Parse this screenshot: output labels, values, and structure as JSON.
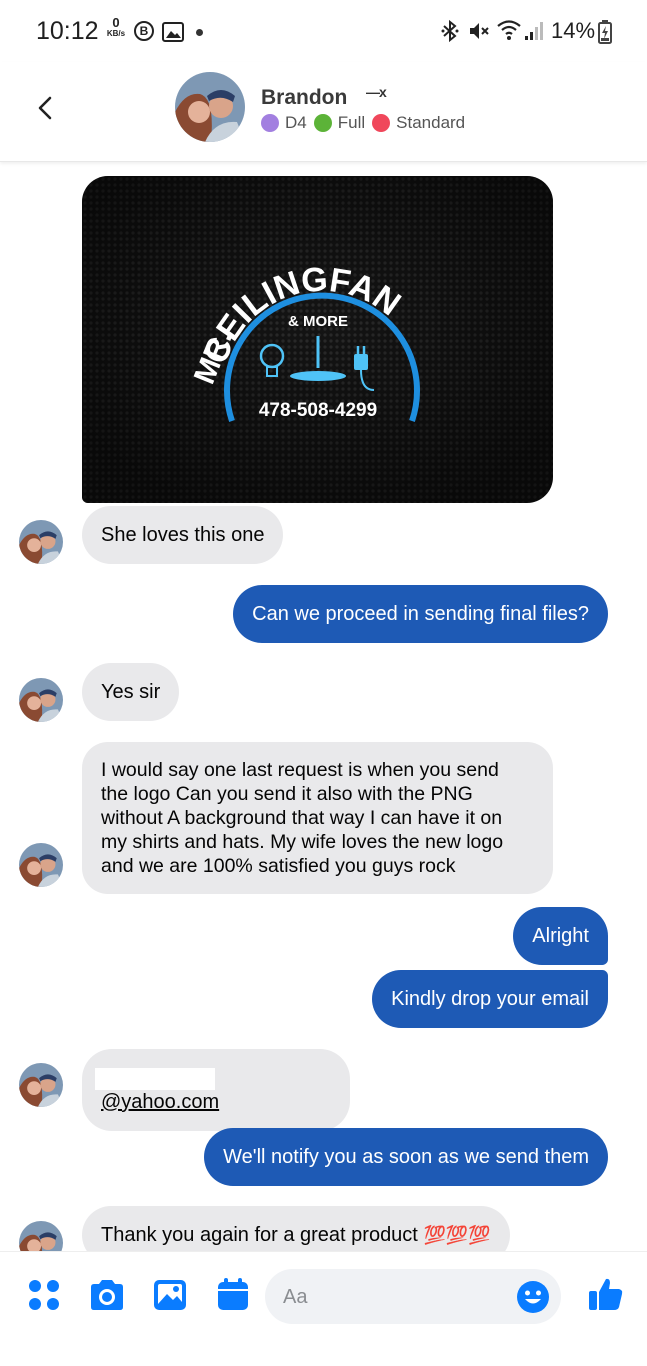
{
  "status_bar": {
    "time": "10:12",
    "net_speed_value": "0",
    "net_speed_unit": "KB/s",
    "notif_letter": "B",
    "battery_percent": "14%"
  },
  "header": {
    "contact_name": "Brandon",
    "contact_name_trailing": "—x",
    "tags": [
      {
        "label": "D4",
        "color": "#a27fe0"
      },
      {
        "label": "Full",
        "color": "#5cb338"
      },
      {
        "label": "Standard",
        "color": "#f0475b"
      }
    ]
  },
  "logo_image": {
    "brand_arc": "CEILINGFAN",
    "brand_prefix": "MR.",
    "tagline": "& MORE",
    "phone": "478-508-4299"
  },
  "messages": [
    {
      "from": "contact",
      "text": "She loves this one"
    },
    {
      "from": "me",
      "text": "Can we proceed in sending final files?"
    },
    {
      "from": "contact",
      "text": "Yes sir"
    },
    {
      "from": "contact",
      "lines": [
        "I would say one last request is when you send",
        "the logo Can you send it also with the PNG",
        "without A background that way I can have it on",
        "my shirts and hats. My wife loves the new logo",
        "and we are 100% satisfied you guys rock"
      ]
    },
    {
      "from": "me",
      "text": "Alright"
    },
    {
      "from": "me",
      "text": "Kindly drop your email"
    },
    {
      "from": "contact",
      "text": "@yahoo.com"
    },
    {
      "from": "me",
      "text": "We'll notify you as soon as we send them"
    },
    {
      "from": "contact",
      "text": "Thank you again for a great product",
      "emoji": "💯💯💯"
    }
  ],
  "composer": {
    "placeholder": "Aa",
    "icons": [
      "apps-icon",
      "camera-icon",
      "gallery-icon",
      "calendar-icon",
      "emoji-icon",
      "thumbs-up-icon"
    ]
  },
  "colors": {
    "outgoing_bubble": "#1e5ab5",
    "incoming_bubble": "#e9e9eb",
    "accent": "#0a7cff"
  }
}
